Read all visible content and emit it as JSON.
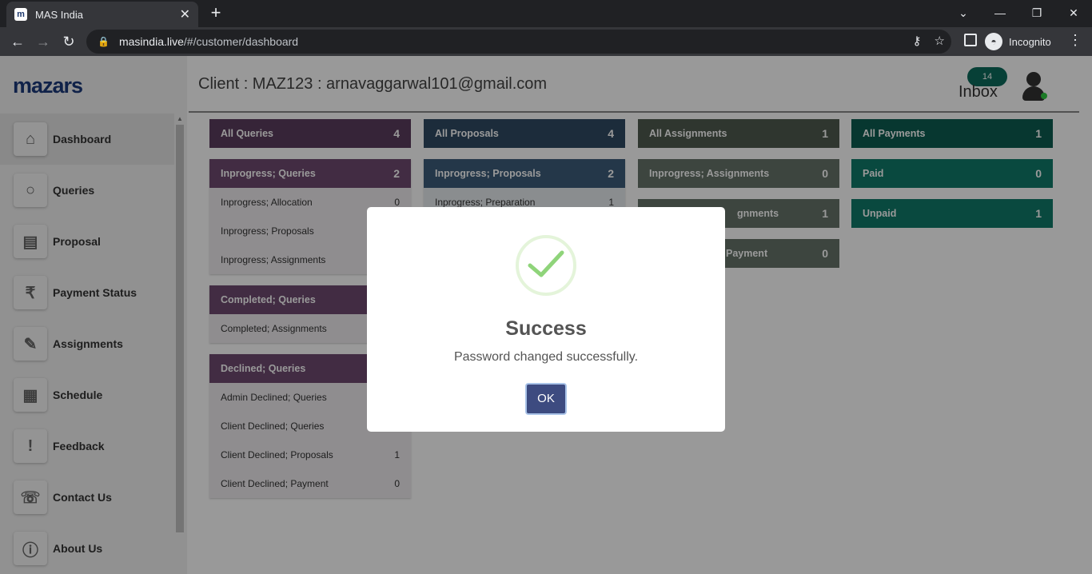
{
  "browser": {
    "tab_title": "MAS India",
    "favicon": "m",
    "url_host": "masindia.live",
    "url_path": "/#/customer/dashboard",
    "incognito_label": "Incognito"
  },
  "app": {
    "logo": "mazars",
    "header_title": "Client : MAZ123 : arnavaggarwal101@gmail.com",
    "inbox_count": "14",
    "inbox_label": "Inbox"
  },
  "sidebar": {
    "items": [
      {
        "label": "Dashboard",
        "icon": "home-icon"
      },
      {
        "label": "Queries",
        "icon": "search-icon"
      },
      {
        "label": "Proposal",
        "icon": "proposal-icon"
      },
      {
        "label": "Payment Status",
        "icon": "payment-icon"
      },
      {
        "label": "Assignments",
        "icon": "assignment-icon"
      },
      {
        "label": "Schedule",
        "icon": "calendar-icon"
      },
      {
        "label": "Feedback",
        "icon": "feedback-icon"
      },
      {
        "label": "Contact Us",
        "icon": "contact-icon"
      },
      {
        "label": "About Us",
        "icon": "info-icon"
      }
    ]
  },
  "dashboard": {
    "queries": {
      "all": {
        "label": "All Queries",
        "count": "4"
      },
      "inprogress": {
        "label": "Inprogress; Queries",
        "count": "2"
      },
      "inprogress_items": [
        {
          "label": "Inprogress; Allocation",
          "count": "0"
        },
        {
          "label": "Inprogress; Proposals",
          "count": ""
        },
        {
          "label": "Inprogress; Assignments",
          "count": ""
        }
      ],
      "completed": {
        "label": "Completed; Queries",
        "count": ""
      },
      "completed_items": [
        {
          "label": "Completed; Assignments",
          "count": ""
        }
      ],
      "declined": {
        "label": "Declined; Queries",
        "count": ""
      },
      "declined_items": [
        {
          "label": "Admin Declined; Queries",
          "count": ""
        },
        {
          "label": "Client Declined; Queries",
          "count": ""
        },
        {
          "label": "Client Declined; Proposals",
          "count": "1"
        },
        {
          "label": "Client Declined; Payment",
          "count": "0"
        }
      ]
    },
    "proposals": {
      "all": {
        "label": "All Proposals",
        "count": "4"
      },
      "inprogress": {
        "label": "Inprogress; Proposals",
        "count": "2"
      },
      "inprogress_items": [
        {
          "label": "Inprogress; Preparation",
          "count": "1"
        }
      ]
    },
    "assignments": {
      "all": {
        "label": "All Assignments",
        "count": "1"
      },
      "inprogress": {
        "label": "Inprogress; Assignments",
        "count": "0"
      },
      "third": {
        "label": "gnments",
        "count": "1"
      },
      "fourth": {
        "label": "Payment",
        "count": "0"
      }
    },
    "payments": {
      "all": {
        "label": "All Payments",
        "count": "1"
      },
      "paid": {
        "label": "Paid",
        "count": "0"
      },
      "unpaid": {
        "label": "Unpaid",
        "count": "1"
      }
    }
  },
  "modal": {
    "title": "Success",
    "message": "Password changed successfully.",
    "ok_label": "OK"
  },
  "colors": {
    "queries_card": "#5b3d5e",
    "proposals_card": "#2f4a63",
    "assignments_card": "#4f5a4f",
    "payments_card": "#0d6b5c",
    "ok_button": "#3d4b80"
  }
}
